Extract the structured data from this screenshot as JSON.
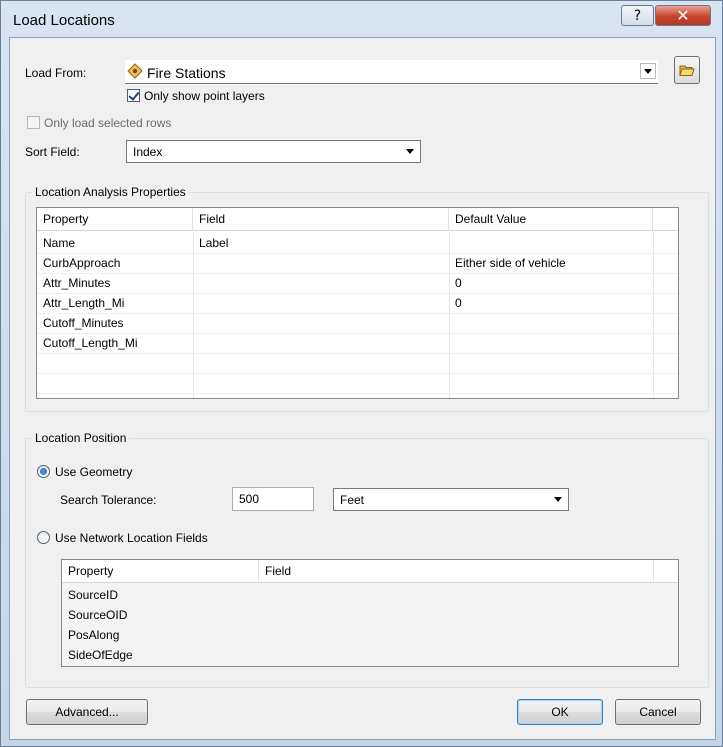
{
  "window": {
    "title": "Load Locations",
    "help_glyph": "?",
    "close_glyph": "✕"
  },
  "load_from": {
    "label": "Load From:",
    "value": "Fire Stations",
    "only_point_layers_label": "Only show point layers",
    "only_point_layers_checked": true
  },
  "only_selected": {
    "label": "Only load selected rows",
    "checked": false,
    "enabled": false
  },
  "sort_field": {
    "label": "Sort Field:",
    "value": "Index"
  },
  "analysis_props": {
    "title": "Location Analysis Properties",
    "headers": [
      "Property",
      "Field",
      "Default Value"
    ],
    "rows": [
      [
        "Name",
        "Label",
        ""
      ],
      [
        "CurbApproach",
        "",
        "Either side of vehicle"
      ],
      [
        "Attr_Minutes",
        "",
        "0"
      ],
      [
        "Attr_Length_Mi",
        "",
        "0"
      ],
      [
        "Cutoff_Minutes",
        "",
        ""
      ],
      [
        "Cutoff_Length_Mi",
        "",
        ""
      ],
      [
        "",
        "",
        ""
      ],
      [
        "",
        "",
        ""
      ]
    ]
  },
  "location_position": {
    "title": "Location Position",
    "use_geometry_label": "Use Geometry",
    "use_geometry_selected": true,
    "search_tolerance_label": "Search Tolerance:",
    "search_tolerance_value": "500",
    "units_value": "Feet",
    "use_network_label": "Use Network Location Fields",
    "network_headers": [
      "Property",
      "Field"
    ],
    "network_rows": [
      [
        "SourceID",
        ""
      ],
      [
        "SourceOID",
        ""
      ],
      [
        "PosAlong",
        ""
      ],
      [
        "SideOfEdge",
        ""
      ]
    ]
  },
  "buttons": {
    "advanced": "Advanced...",
    "ok": "OK",
    "cancel": "Cancel"
  },
  "icons": {
    "layer_icon": "point-layer-icon",
    "browse_icon": "open-folder-icon"
  },
  "colors": {
    "accent": "#3c7fb1",
    "close": "#c7432c"
  }
}
